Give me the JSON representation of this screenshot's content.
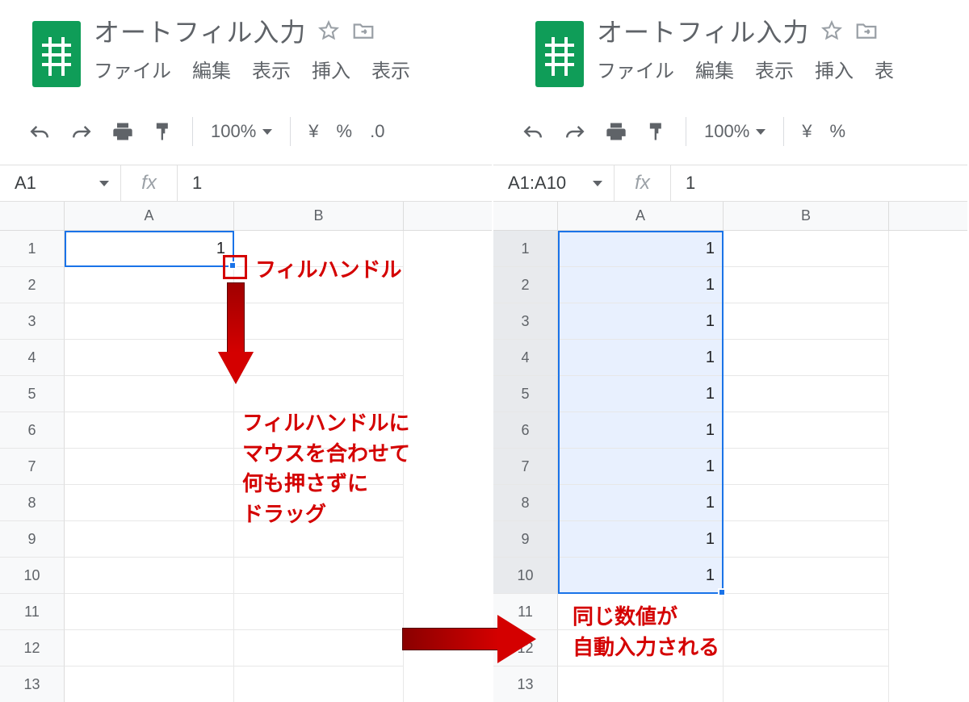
{
  "left": {
    "title": "オートフィル入力",
    "menu": [
      "ファイル",
      "編集",
      "表示",
      "挿入",
      "表示"
    ],
    "zoom": "100%",
    "fmt": [
      "¥",
      "%",
      ".0"
    ],
    "namebox": "A1",
    "fx": "fx",
    "fxval": "1",
    "colHeaders": [
      "A",
      "B"
    ],
    "rowHeaders": [
      "1",
      "2",
      "3",
      "4",
      "5",
      "6",
      "7",
      "8",
      "9",
      "10",
      "11",
      "12",
      "13"
    ],
    "cellA1": "1",
    "anno": {
      "fillHandleLabel": "フィルハンドル",
      "instructions": "フィルハンドルに\nマウスを合わせて\n何も押さずに\nドラッグ"
    }
  },
  "right": {
    "title": "オートフィル入力",
    "menu": [
      "ファイル",
      "編集",
      "表示",
      "挿入",
      "表"
    ],
    "zoom": "100%",
    "fmt": [
      "¥",
      "%"
    ],
    "namebox": "A1:A10",
    "fx": "fx",
    "fxval": "1",
    "colHeaders": [
      "A",
      "B"
    ],
    "rowHeaders": [
      "1",
      "2",
      "3",
      "4",
      "5",
      "6",
      "7",
      "8",
      "9",
      "10",
      "11",
      "12",
      "13"
    ],
    "filledValues": [
      "1",
      "1",
      "1",
      "1",
      "1",
      "1",
      "1",
      "1",
      "1",
      "1"
    ],
    "anno": {
      "result": "同じ数値が\n自動入力される"
    }
  }
}
